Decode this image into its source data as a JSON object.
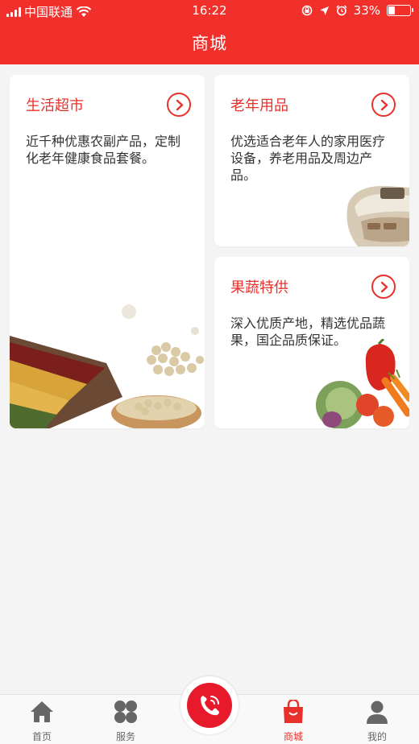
{
  "status_bar": {
    "carrier": "中国联通",
    "time": "16:22",
    "battery": "33%",
    "battery_level": 0.33
  },
  "header": {
    "title": "商城"
  },
  "cards": [
    {
      "title": "生活超市",
      "desc": "近千种优惠农副产品，定制化老年健康食品套餐。",
      "icon": "chevron-right-icon"
    },
    {
      "title": "老年用品",
      "desc": "优选适合老年人的家用医疗设备，养老用品及周边产品。",
      "icon": "chevron-right-icon"
    },
    {
      "title": "果蔬特供",
      "desc": "深入优质产地，精选优品蔬果，国企品质保证。",
      "icon": "chevron-right-icon"
    }
  ],
  "tabbar": {
    "items": [
      {
        "label": "首页",
        "icon": "home-icon"
      },
      {
        "label": "服务",
        "icon": "grid-icon"
      },
      {
        "label": "商城",
        "icon": "shopping-bag-icon",
        "active": true
      },
      {
        "label": "我的",
        "icon": "user-icon"
      }
    ],
    "center_icon": "phone-call-icon"
  },
  "colors": {
    "primary": "#f1302c",
    "accent": "#e8312b",
    "background": "#f4f4f4"
  }
}
